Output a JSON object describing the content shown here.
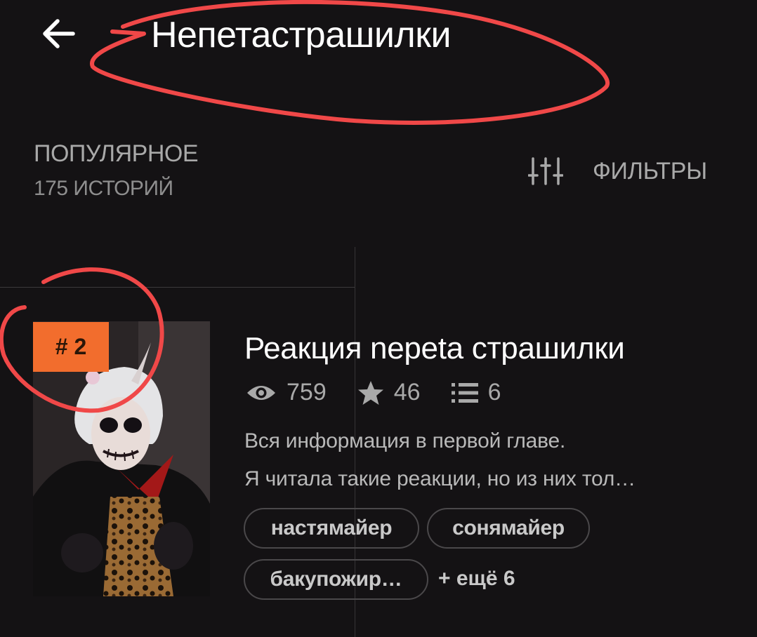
{
  "header": {
    "title": "Непетастрашилки"
  },
  "section": {
    "sort_label": "ПОПУЛЯРНОЕ",
    "story_count": "175 ИСТОРИЙ",
    "filters_label": "ФИЛЬТРЫ"
  },
  "story": {
    "rank": "# 2",
    "title": "Реакция nepeta страшилки",
    "views": "759",
    "votes": "46",
    "parts": "6",
    "description_line1": "Вся информация в первой главе.",
    "description_line2": "Я читала такие реакции, но из них тол…",
    "tags": [
      "настямайер",
      "сонямайер",
      "бакупожир…"
    ],
    "more_tags": "+ ещё 6"
  },
  "colors": {
    "background": "#141214",
    "rank_badge": "#f26d2d",
    "annotation": "#f04848"
  },
  "icons": [
    "back-arrow-icon",
    "filters-sliders-icon",
    "eye-icon",
    "star-icon",
    "list-icon"
  ]
}
